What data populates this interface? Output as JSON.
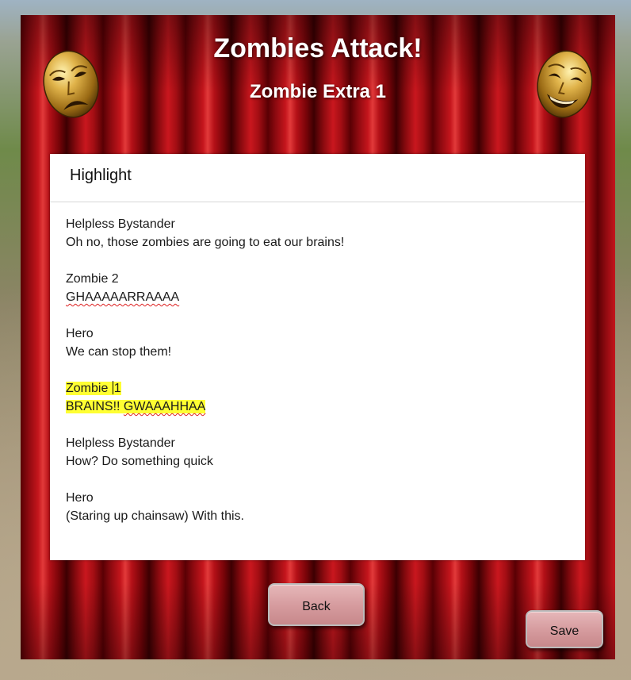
{
  "header": {
    "title": "Zombies Attack!",
    "subtitle": "Zombie Extra 1"
  },
  "panel": {
    "heading": "Highlight",
    "script_lines": [
      {
        "speaker": "Helpless Bystander",
        "line": "Oh no, those zombies are going to eat our brains!"
      },
      {
        "speaker": "Zombie 2",
        "line": "GHAAAAARRAAAA"
      },
      {
        "speaker": "Hero",
        "line": "We can stop them!"
      },
      {
        "speaker": "Zombie 1",
        "line_part1": "BRAINS!!",
        "line_part2": "GWAAAHHAA",
        "highlighted": true
      },
      {
        "speaker": "Helpless Bystander",
        "line": "How? Do something quick"
      },
      {
        "speaker": "Hero",
        "line": "(Staring up chainsaw) With this."
      }
    ],
    "highlight_color": "#ffff33"
  },
  "zombie1_speaker_prefix": "Zombie ",
  "zombie1_speaker_suffix": "1",
  "buttons": {
    "back": "Back",
    "save": "Save"
  },
  "icons": {
    "left": "tragedy-mask-icon",
    "right": "comedy-mask-icon"
  },
  "colors": {
    "curtain": "#b51118",
    "button": "#d59a9d"
  }
}
